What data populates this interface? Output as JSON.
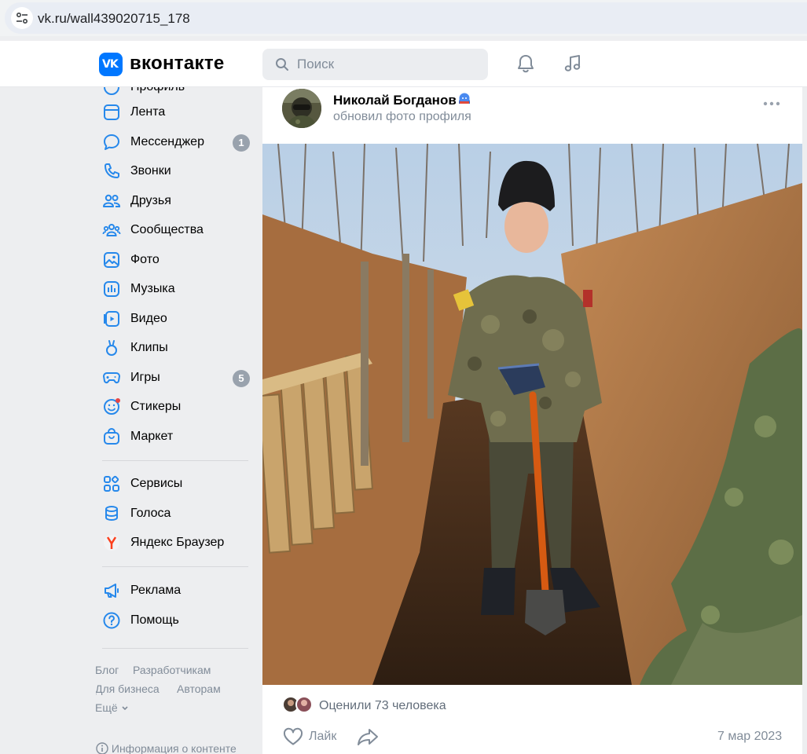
{
  "browser": {
    "url": "vk.ru/wall439020715_178"
  },
  "header": {
    "brand": "вконтакте",
    "search_placeholder": "Поиск",
    "accent": "#0077ff"
  },
  "sidebar": {
    "partial_top_label": "Профиль",
    "items": [
      {
        "label": "Лента",
        "icon": "newsfeed-icon",
        "badge": ""
      },
      {
        "label": "Мессенджер",
        "icon": "messenger-icon",
        "badge": "1"
      },
      {
        "label": "Звонки",
        "icon": "phone-icon",
        "badge": ""
      },
      {
        "label": "Друзья",
        "icon": "friends-icon",
        "badge": ""
      },
      {
        "label": "Сообщества",
        "icon": "communities-icon",
        "badge": ""
      },
      {
        "label": "Фото",
        "icon": "photo-icon",
        "badge": ""
      },
      {
        "label": "Музыка",
        "icon": "music-icon",
        "badge": ""
      },
      {
        "label": "Видео",
        "icon": "video-icon",
        "badge": ""
      },
      {
        "label": "Клипы",
        "icon": "clips-icon",
        "badge": ""
      },
      {
        "label": "Игры",
        "icon": "games-icon",
        "badge": "5"
      },
      {
        "label": "Стикеры",
        "icon": "stickers-icon",
        "badge": ""
      },
      {
        "label": "Маркет",
        "icon": "market-icon",
        "badge": ""
      },
      {
        "label": "Сервисы",
        "icon": "services-icon",
        "badge": ""
      },
      {
        "label": "Голоса",
        "icon": "votes-icon",
        "badge": ""
      },
      {
        "label": "Яндекс Браузер",
        "icon": "yandex-browser-icon",
        "badge": ""
      },
      {
        "label": "Реклама",
        "icon": "ads-icon",
        "badge": ""
      },
      {
        "label": "Помощь",
        "icon": "help-icon",
        "badge": ""
      }
    ],
    "footer": {
      "blog": "Блог",
      "developers": "Разработчикам",
      "business": "Для бизнеса",
      "authors": "Авторам",
      "more": "Ещё",
      "info": "Информация о контенте"
    }
  },
  "post": {
    "author": "Николай Богданов",
    "action": "обновил фото профиля",
    "likes_text": "Оценили 73 человека",
    "like_label": "Лайк",
    "date": "7 мар 2023"
  }
}
